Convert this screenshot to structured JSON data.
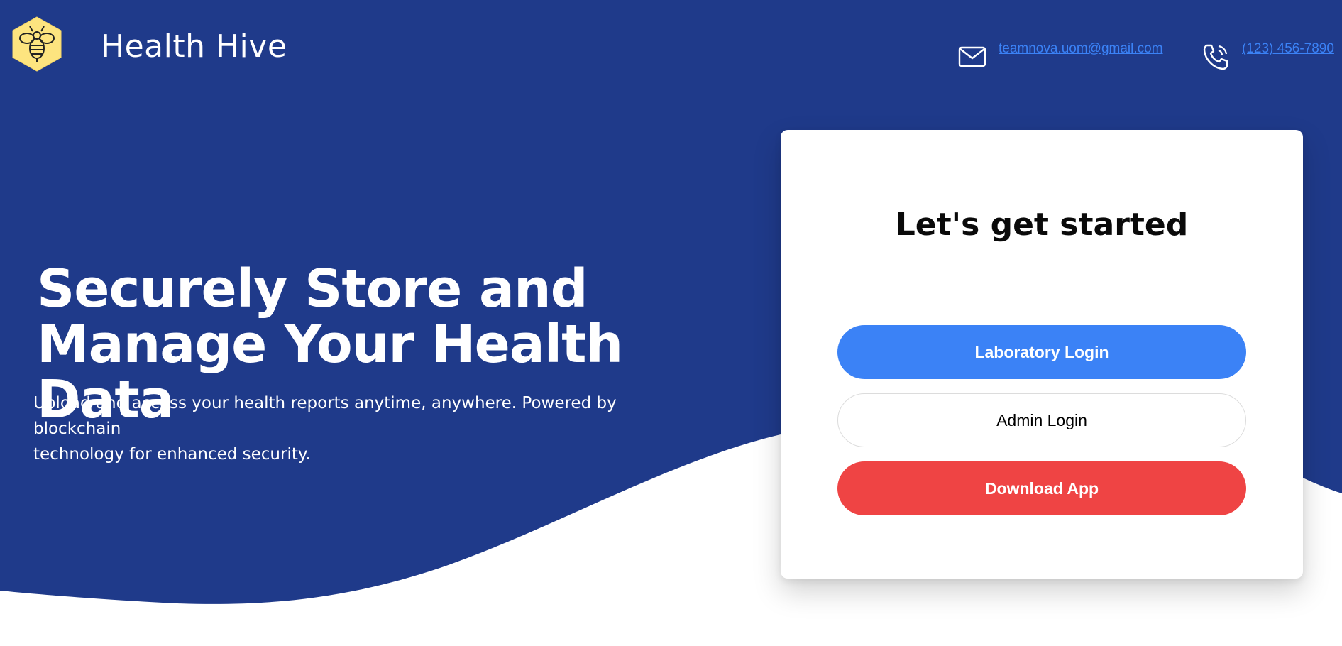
{
  "brand": {
    "name": "Health Hive",
    "logo_icon": "bee-hexagon-icon"
  },
  "contact": {
    "email": "teamnova.uom@gmail.com",
    "phone": "(123) 456-7890",
    "email_icon": "mail-icon",
    "phone_icon": "phone-icon"
  },
  "hero": {
    "title_line1": "Securely Store and",
    "title_line2": "Manage Your Health Data",
    "subtitle_line1": "Upload and access your health reports anytime, anywhere. Powered by blockchain",
    "subtitle_line2": "technology for enhanced security."
  },
  "card": {
    "title": "Let's get started",
    "buttons": {
      "laboratory_login": "Laboratory Login",
      "admin_login": "Admin Login",
      "download_app": "Download App"
    }
  },
  "colors": {
    "hero_bg": "#1f3a8a",
    "primary_button": "#3b82f6",
    "danger_button": "#ef4444",
    "logo_fill": "#fde47f",
    "link": "#3b82f6"
  }
}
